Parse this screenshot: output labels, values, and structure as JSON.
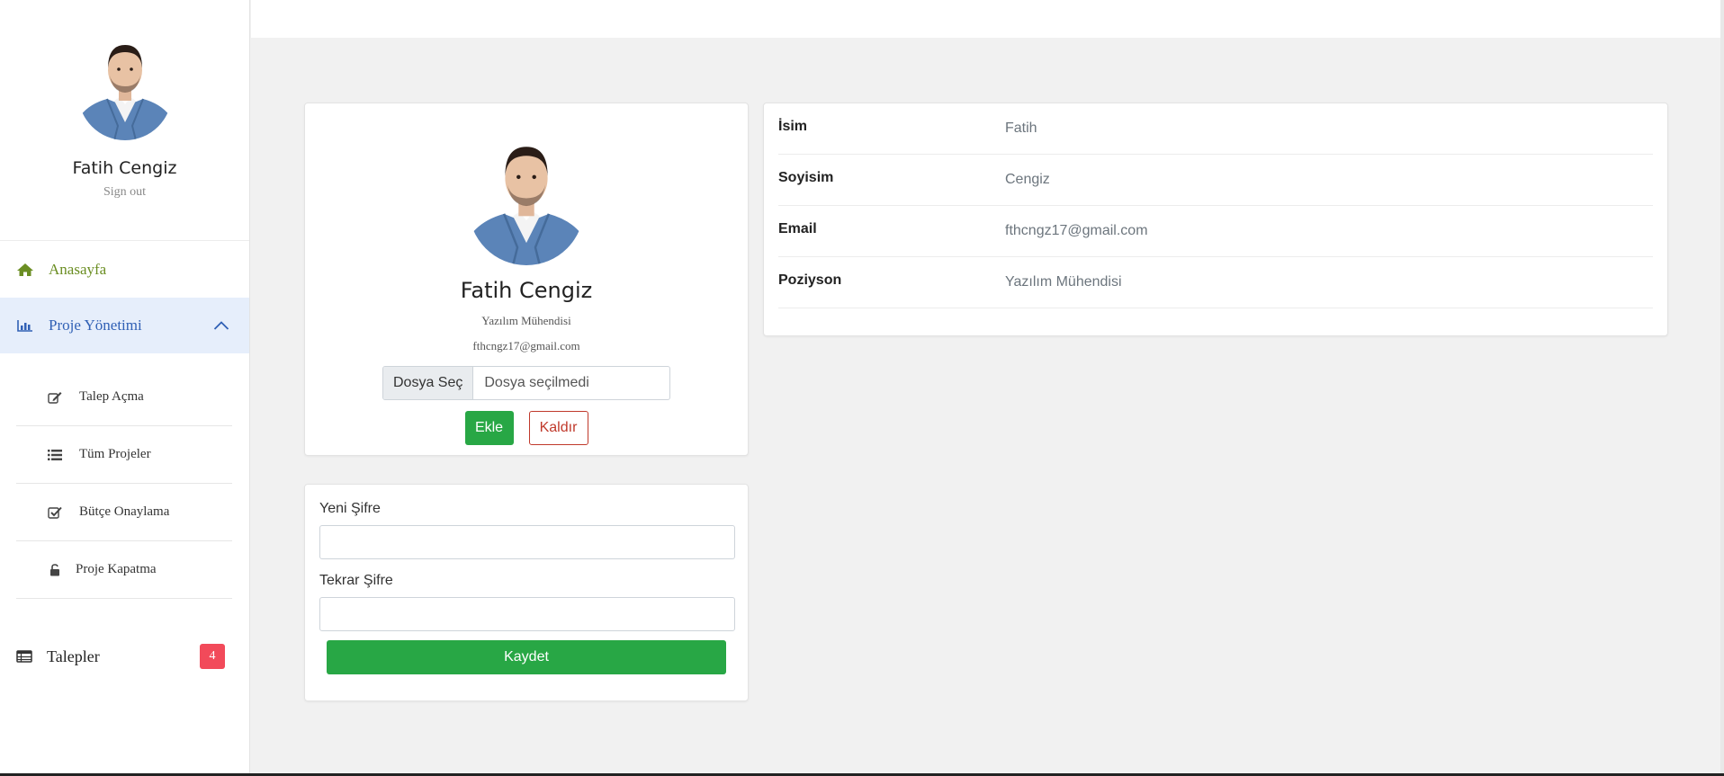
{
  "user": {
    "name": "Fatih Cengiz",
    "sign_out": "Sign out",
    "position": "Yazılım Mühendisi",
    "email": "fthcngz17@gmail.com"
  },
  "sidebar": {
    "home": {
      "label": "Anasayfa",
      "icon": "home-icon"
    },
    "project_management": {
      "label": "Proje Yönetimi",
      "icon": "bar-chart-icon",
      "expanded": true
    },
    "sub_items": [
      {
        "label": "Talep Açma",
        "icon": "edit-icon"
      },
      {
        "label": "Tüm Projeler",
        "icon": "list-icon"
      },
      {
        "label": "Bütçe Onaylama",
        "icon": "check-square-icon"
      },
      {
        "label": "Proje Kapatma",
        "icon": "unlock-icon"
      }
    ],
    "requests": {
      "label": "Talepler",
      "icon": "table-icon",
      "badge": "4"
    }
  },
  "profile_card": {
    "file_button": "Dosya Seç",
    "file_placeholder": "Dosya seçilmedi",
    "add_button": "Ekle",
    "remove_button": "Kaldır"
  },
  "password_card": {
    "new_password_label": "Yeni Şifre",
    "repeat_password_label": "Tekrar Şifre",
    "save_button": "Kaydet"
  },
  "info": [
    {
      "key": "İsim",
      "value": "Fatih"
    },
    {
      "key": "Soyisim",
      "value": "Cengiz"
    },
    {
      "key": "Email",
      "value": "fthcngz17@gmail.com"
    },
    {
      "key": "Poziyson",
      "value": "Yazılım Mühendisi"
    }
  ],
  "colors": {
    "home": "#6b8e23",
    "active_nav": "#3060b5",
    "active_nav_bg": "#e6eefb",
    "success": "#28a745",
    "danger": "#c0392b",
    "badge": "#f24a5a"
  }
}
